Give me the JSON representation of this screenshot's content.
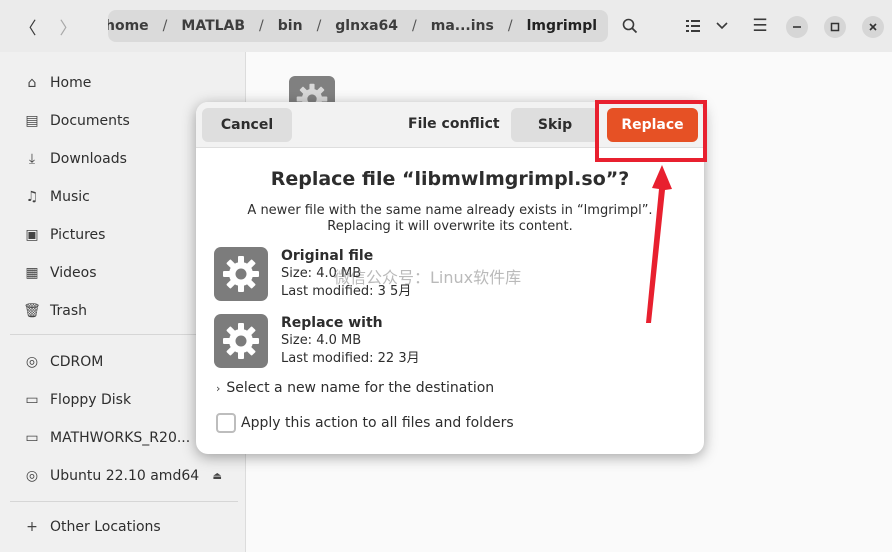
{
  "window": {
    "path_segments": [
      "home",
      "MATLAB",
      "bin",
      "glnxa64",
      "ma...ins",
      "lmgrimpl"
    ],
    "path_separator": "/",
    "icons": {
      "back": "chevron-left-icon",
      "forward": "chevron-right-icon",
      "path_menu": "kebab-menu-icon",
      "search": "search-icon",
      "view_list": "list-view-icon",
      "view_menu": "chevron-down-icon",
      "menu": "hamburger-menu-icon",
      "minimize": "minimize-icon",
      "maximize": "maximize-icon",
      "close": "close-icon"
    }
  },
  "sidebar": {
    "items": [
      {
        "label": "Home",
        "icon": "home-icon"
      },
      {
        "label": "Documents",
        "icon": "document-icon"
      },
      {
        "label": "Downloads",
        "icon": "download-icon"
      },
      {
        "label": "Music",
        "icon": "music-icon"
      },
      {
        "label": "Pictures",
        "icon": "picture-icon"
      },
      {
        "label": "Videos",
        "icon": "video-icon"
      },
      {
        "label": "Trash",
        "icon": "trash-icon"
      },
      {
        "label": "CDROM",
        "icon": "disc-icon"
      },
      {
        "label": "Floppy Disk",
        "icon": "drive-icon"
      },
      {
        "label": "MATHWORKS_R20...",
        "icon": "drive-icon"
      },
      {
        "label": "Ubuntu 22.10 amd64",
        "icon": "disc-icon",
        "eject_icon": "eject-icon"
      },
      {
        "label": "Other Locations",
        "icon": "plus-icon"
      }
    ]
  },
  "dialog": {
    "title": "File conflict",
    "cancel_label": "Cancel",
    "skip_label": "Skip",
    "replace_label": "Replace",
    "heading": "Replace file “libmwlmgrimpl.so”?",
    "description_line1": "A newer file with the same name already exists in “lmgrimpl”.",
    "description_line2": "Replacing it will overwrite its content.",
    "original": {
      "title": "Original file",
      "size": "Size: 4.0 MB",
      "modified": "Last modified: 3 5月",
      "icon": "settings-file-icon"
    },
    "replacement": {
      "title": "Replace with",
      "size": "Size: 4.0 MB",
      "modified": "Last modified: 22 3月",
      "icon": "settings-file-icon"
    },
    "expander_label": "Select a new name for the destination",
    "apply_all_label": "Apply this action to all files and folders",
    "apply_all_checked": false
  },
  "watermark": "微信公众号：Linux软件库",
  "colors": {
    "accent": "#e65125",
    "annotation": "#e8202f",
    "desktop": "#5b2444"
  }
}
